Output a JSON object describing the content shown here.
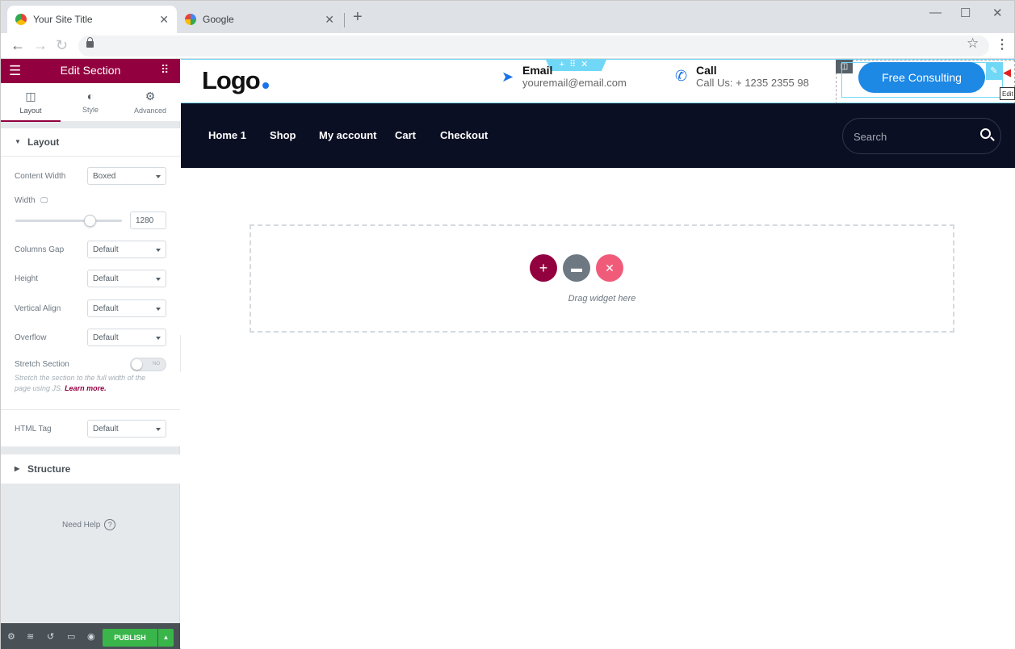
{
  "browser": {
    "tabs": [
      {
        "title": "Your Site Title",
        "close": "✕"
      },
      {
        "title": "Google",
        "close": "✕"
      }
    ],
    "new_tab": "+",
    "controls": {
      "minimize": "—",
      "maximize": "☐",
      "close": "✕"
    }
  },
  "panel": {
    "title": "Edit Section",
    "tabs": [
      {
        "label": "Layout",
        "icon": "◫"
      },
      {
        "label": "Style",
        "icon": "◐"
      },
      {
        "label": "Advanced",
        "icon": "⚙"
      }
    ],
    "layout_section": {
      "heading": "Layout",
      "content_width": {
        "label": "Content Width",
        "value": "Boxed"
      },
      "width": {
        "label": "Width",
        "value": "1280",
        "slider_fraction": 0.7
      },
      "columns_gap": {
        "label": "Columns Gap",
        "value": "Default"
      },
      "height": {
        "label": "Height",
        "value": "Default"
      },
      "vertical_align": {
        "label": "Vertical Align",
        "value": "Default"
      },
      "overflow": {
        "label": "Overflow",
        "value": "Default"
      },
      "stretch_section": {
        "label": "Stretch Section",
        "toggle": "NO",
        "description": "Stretch the section to the full width of the page using JS.",
        "learn_more": "Learn more."
      },
      "html_tag": {
        "label": "HTML Tag",
        "value": "Default"
      }
    },
    "structure_heading": "Structure",
    "help": "Need Help",
    "publish": "PUBLISH"
  },
  "site": {
    "logo": "Logo",
    "email": {
      "heading": "Email",
      "value": "youremail@email.com"
    },
    "call": {
      "heading": "Call",
      "value": "Call Us: + 1235 2355 98"
    },
    "cta": "Free Consulting",
    "edit_tooltip": "Edit",
    "nav": [
      "Home 1",
      "Shop",
      "My account",
      "Cart",
      "Checkout"
    ],
    "search_placeholder": "Search",
    "drop_text": "Drag widget here"
  },
  "colors": {
    "accent": "#93003f",
    "publish": "#39b54a",
    "nav_bg": "#0b0f23",
    "cta": "#1e88e5"
  }
}
